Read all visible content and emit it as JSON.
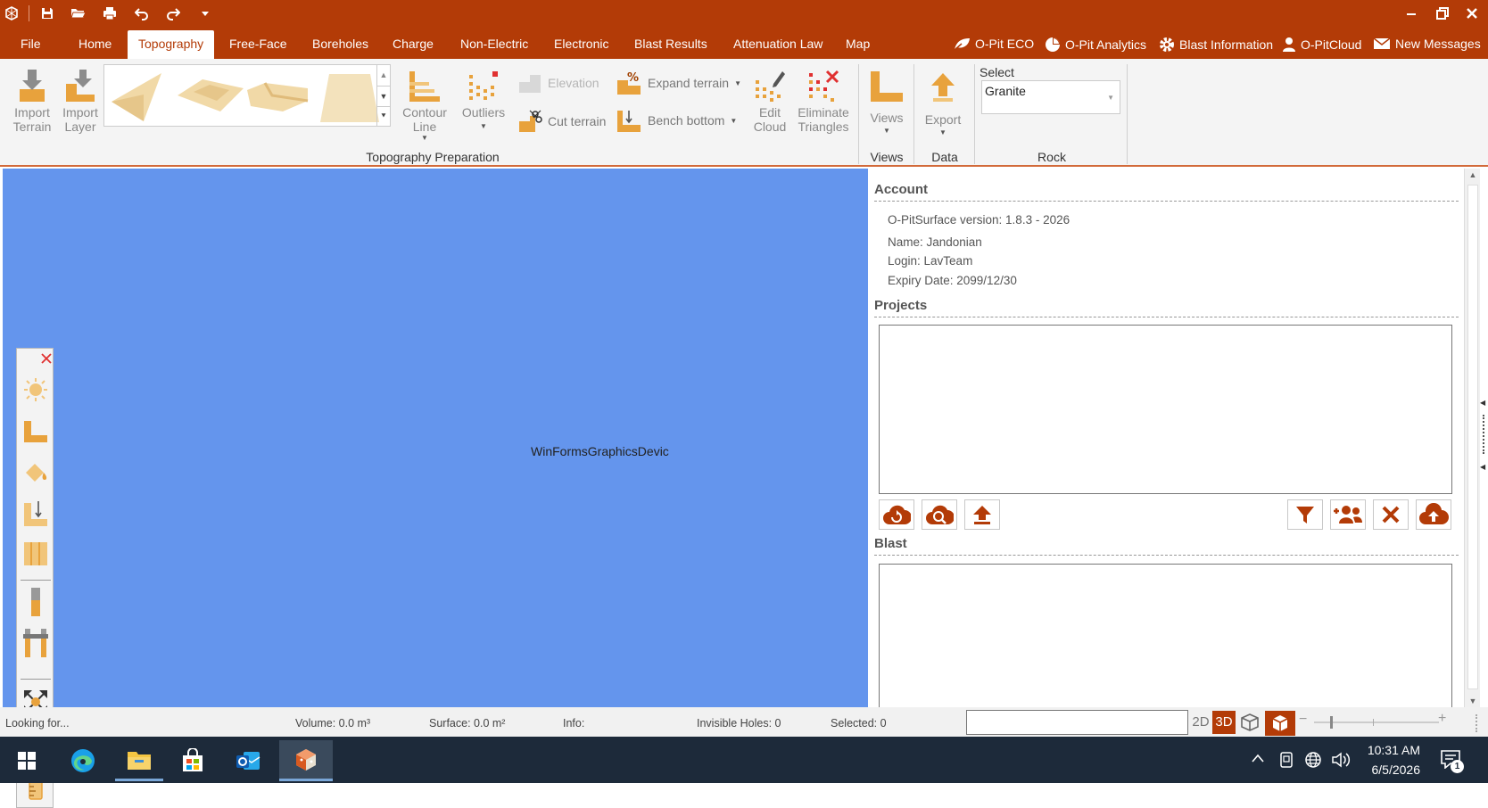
{
  "menu": {
    "file": "File",
    "tabs": [
      "Home",
      "Topography",
      "Free-Face",
      "Boreholes",
      "Charge",
      "Non-Electric",
      "Electronic",
      "Blast Results",
      "Attenuation Law",
      "Map"
    ],
    "right": [
      "O-Pit ECO",
      "O-Pit Analytics",
      "Blast Information",
      "O-PitCloud",
      "New Messages"
    ]
  },
  "ribbon": {
    "import_terrain": [
      "Import",
      "Terrain"
    ],
    "import_layer": [
      "Import",
      "Layer"
    ],
    "contour_line": [
      "Contour",
      "Line"
    ],
    "outliers": "Outliers",
    "elevation": "Elevation",
    "cut_terrain": "Cut terrain",
    "expand_terrain": "Expand terrain",
    "bench_bottom": "Bench bottom",
    "edit_cloud": [
      "Edit",
      "Cloud"
    ],
    "eliminate_triangles": [
      "Eliminate",
      "Triangles"
    ],
    "views": "Views",
    "export": "Export",
    "select_label": "Select",
    "rock_value": "Granite",
    "groups": {
      "topography": "Topography Preparation",
      "views": "Views",
      "data": "Data",
      "rock": "Rock"
    }
  },
  "canvas": {
    "text": "WinFormsGraphicsDevic"
  },
  "panel": {
    "account": "Account",
    "version": "O-PitSurface version: 1.8.3 - 2026",
    "name": "Name: Jandonian",
    "login": "Login: LavTeam",
    "expiry": "Expiry Date: 2099/12/30",
    "projects": "Projects",
    "blast": "Blast"
  },
  "status": {
    "looking": "Looking for...",
    "volume": "Volume: 0.0 m³",
    "surface": "Surface: 0.0 m²",
    "info": "Info:",
    "invisible": "Invisible Holes: 0",
    "selected": "Selected: 0",
    "mode_2d": "2D",
    "mode_3d": "3D"
  },
  "taskbar": {
    "time": "10:31 AM",
    "date": "6/5/2026",
    "notifications": "1"
  },
  "colors": {
    "brand": "#b33b07",
    "canvas": "#6495ed",
    "icon": "#e8a23c"
  }
}
